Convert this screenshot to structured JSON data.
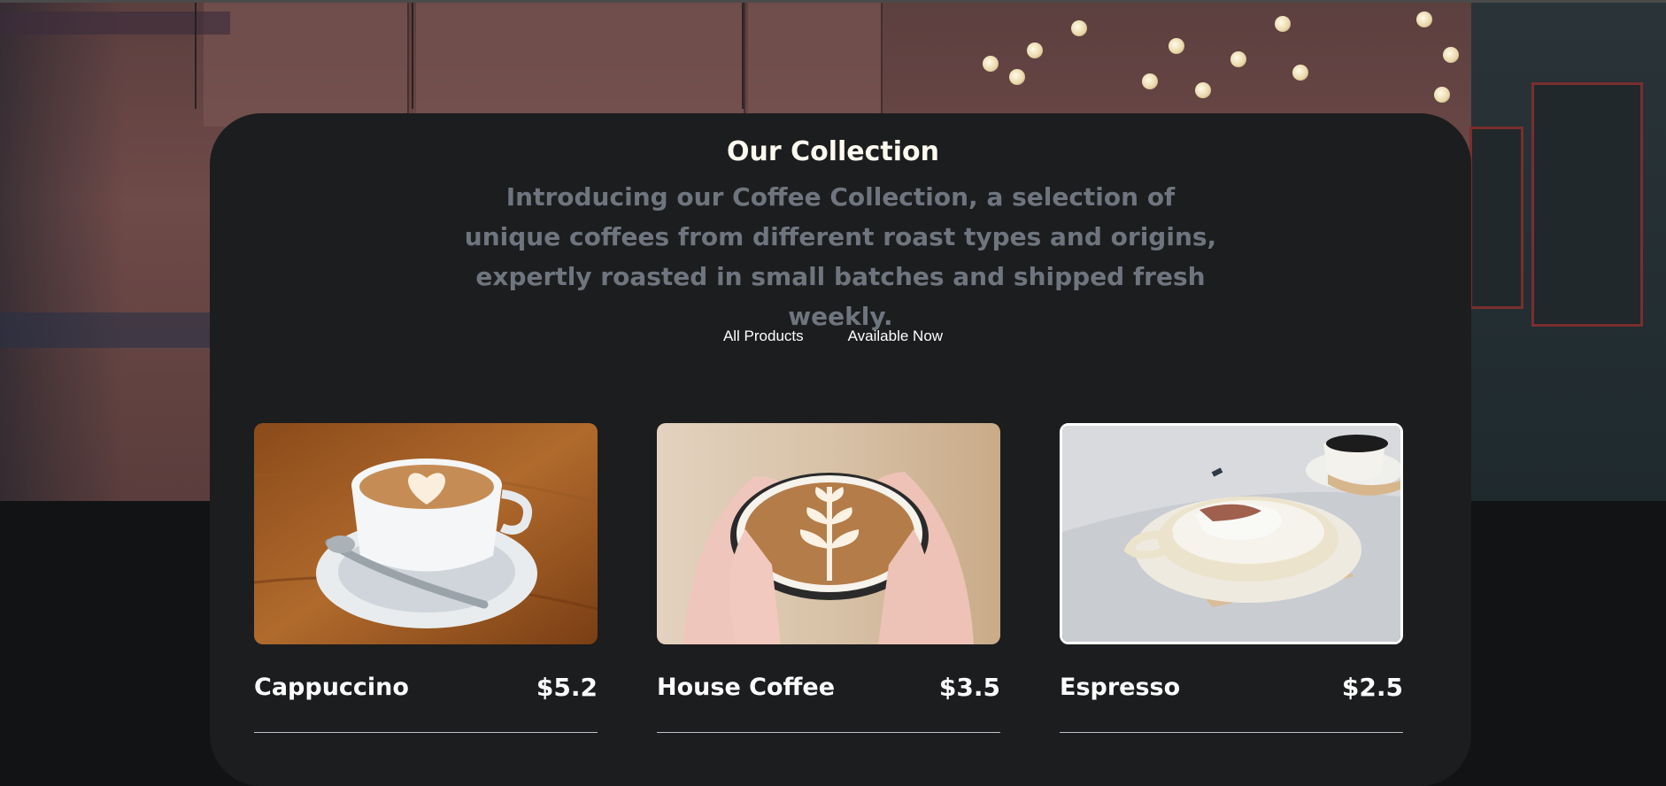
{
  "section": {
    "title": "Our Collection",
    "subtitle": "Introducing our Coffee Collection, a selection of unique coffees from different roast types and origins, expertly roasted in small batches and shipped fresh weekly."
  },
  "tabs": [
    {
      "label": "All Products"
    },
    {
      "label": "Available Now"
    }
  ],
  "products": [
    {
      "name": "Cappuccino",
      "price": "$5.2"
    },
    {
      "name": "House Coffee",
      "price": "$3.5"
    },
    {
      "name": "Espresso",
      "price": "$2.5"
    }
  ],
  "colors": {
    "card_background": "#1c1d1f",
    "page_background": "#111315",
    "subtitle_text": "#6f757e",
    "heading_text": "#fffaf0"
  }
}
